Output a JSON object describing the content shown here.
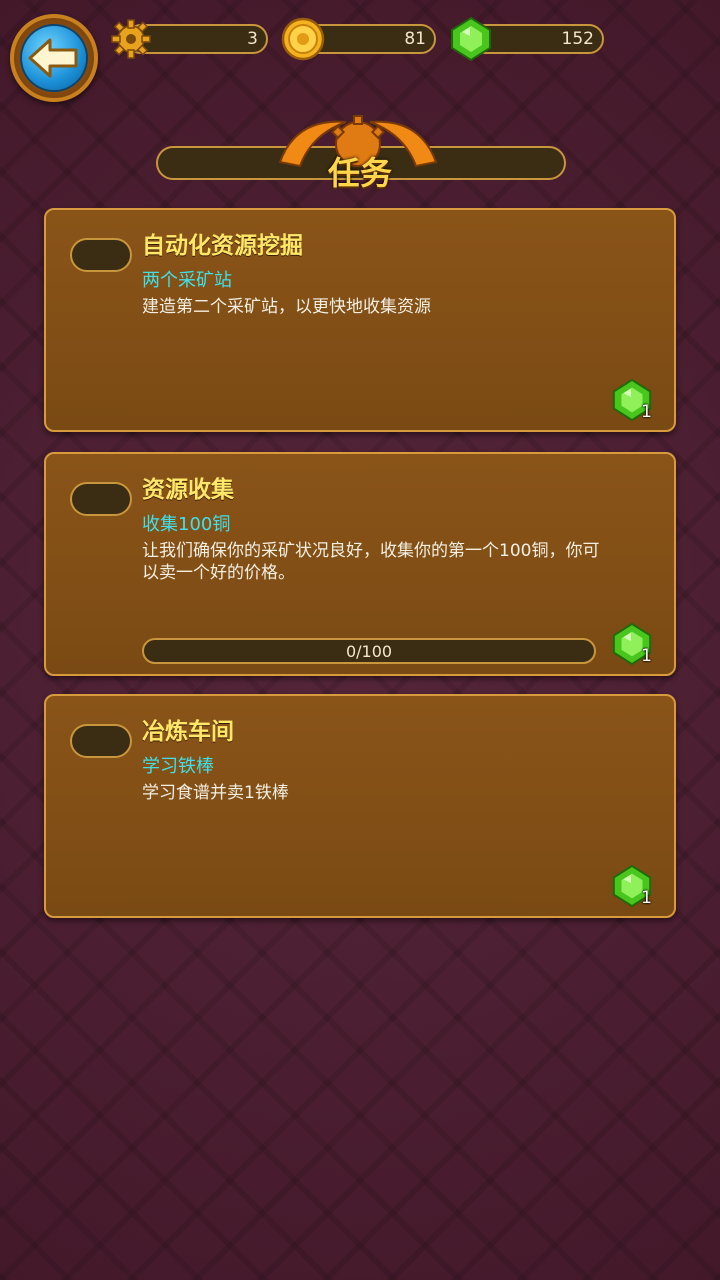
{
  "resources": [
    {
      "icon": "gear-icon",
      "value": "3"
    },
    {
      "icon": "coin-icon",
      "value": "81"
    },
    {
      "icon": "gem-icon",
      "value": "152"
    }
  ],
  "title": "任务",
  "quests": [
    {
      "name": "自动化资源挖掘",
      "subtitle": "两个采矿站",
      "description": "建造第二个采矿站，以更快地收集资源",
      "reward_icon": "gem-icon",
      "reward": "1"
    },
    {
      "name": "资源收集",
      "subtitle": "收集100铜",
      "description": "让我们确保你的采矿状况良好，收集你的第一个100铜，你可以卖一个好的价格。",
      "progress_text": "0/100",
      "progress_fraction": 0,
      "reward_icon": "gem-icon",
      "reward": "1"
    },
    {
      "name": "冶炼车间",
      "subtitle": "学习铁棒",
      "description": "学习食谱并卖1铁棒",
      "reward_icon": "gem-icon",
      "reward": "1"
    }
  ],
  "colors": {
    "accent_gold": "#ffd54a",
    "subtitle_cyan": "#3fe0e8",
    "gem_green": "#59d629",
    "card_brown": "#7a4a14"
  }
}
